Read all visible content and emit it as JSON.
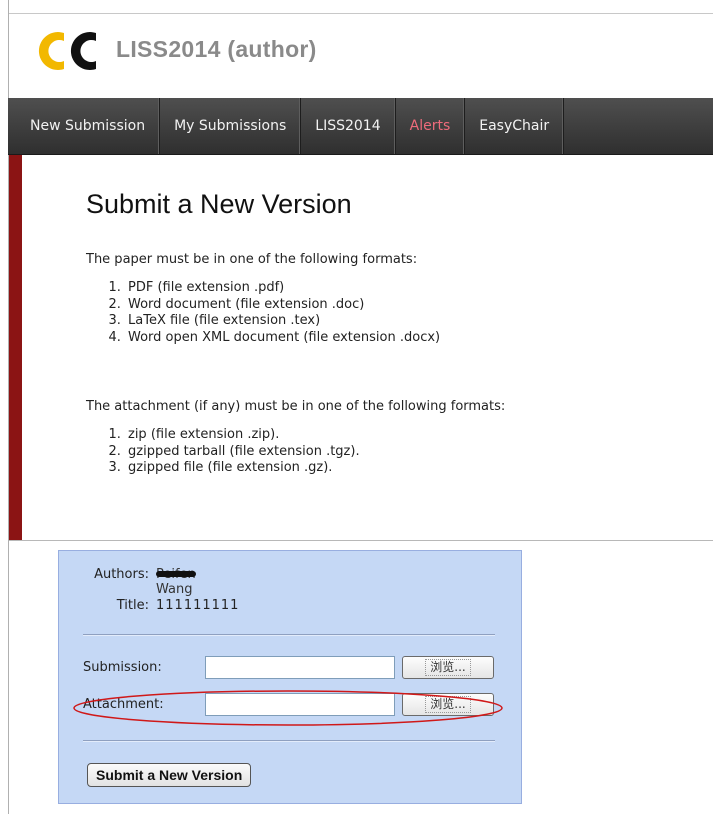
{
  "header": {
    "logo_text": "EC",
    "app_title": "LISS2014 (author)"
  },
  "nav": {
    "items": [
      {
        "label": "New Submission"
      },
      {
        "label": "My Submissions"
      },
      {
        "label": "LISS2014"
      },
      {
        "label": "Alerts"
      },
      {
        "label": "EasyChair"
      }
    ]
  },
  "content": {
    "title": "Submit a New Version",
    "paper_intro": "The paper must be in one of the following formats:",
    "paper_formats": [
      "PDF (file extension .pdf)",
      "Word document (file extension .doc)",
      "LaTeX file (file extension .tex)",
      "Word open XML document (file extension .docx)"
    ],
    "attach_intro": "The attachment (if any) must be in one of the following formats:",
    "attach_formats": [
      "zip (file extension .zip).",
      "gzipped tarball (file extension .tgz).",
      "gzipped file (file extension .gz)."
    ]
  },
  "form": {
    "authors_label": "Authors:",
    "authors_value": "Peifen Wang",
    "title_label": "Title:",
    "title_value": "111111111",
    "submission_label": "Submission:",
    "submission_value": "",
    "attachment_label": "Attachment:",
    "attachment_value": "",
    "browse_label": "浏览...",
    "submit_label": "Submit a New Version"
  },
  "colors": {
    "accent_red": "#8b1414",
    "nav_bg": "#3a3a3a",
    "alert_text": "#ee6b7b",
    "form_bg": "#c5d8f5",
    "logo_yellow": "#f2b800",
    "annotation": "#d01818"
  }
}
